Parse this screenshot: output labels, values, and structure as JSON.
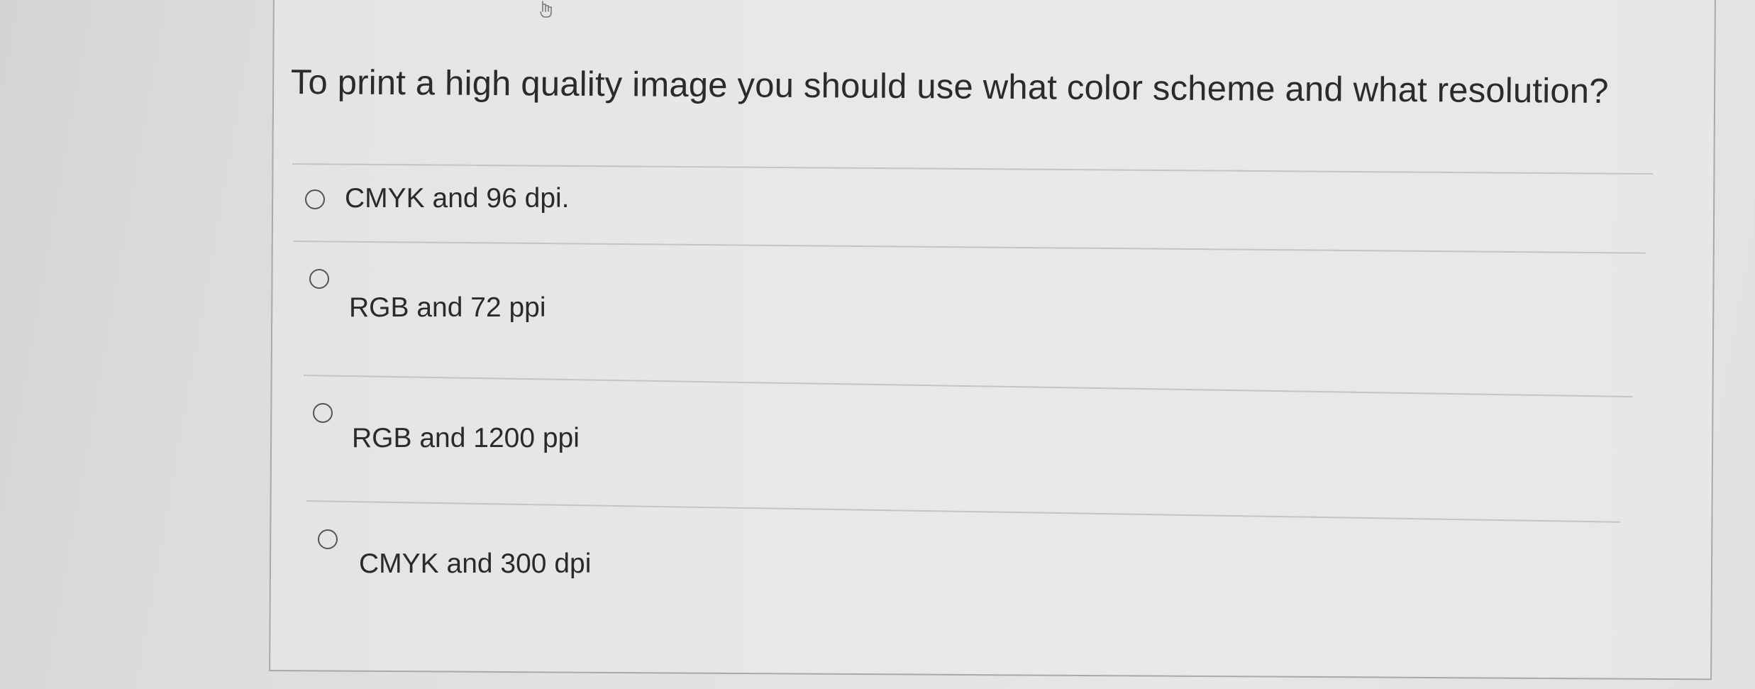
{
  "question": {
    "text": "To print a high quality image you should use what color scheme and what resolution?"
  },
  "options": [
    {
      "label": "CMYK and 96 dpi."
    },
    {
      "label": "RGB and 72 ppi"
    },
    {
      "label": "RGB and 1200 ppi"
    },
    {
      "label": "CMYK and 300 dpi"
    }
  ],
  "icons": {
    "cursor": "hand-pointer-icon",
    "radio": "radio-unselected-icon"
  },
  "colors": {
    "text": "#2b2b2b",
    "divider": "#c4c4c2",
    "frame_border": "#a9a9a7",
    "radio_border": "#555555"
  }
}
